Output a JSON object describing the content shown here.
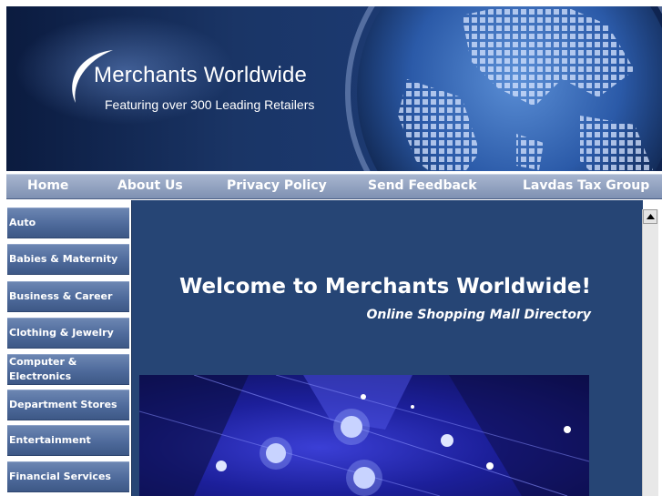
{
  "header": {
    "logo_title": "Merchants Worldwide",
    "logo_tagline": "Featuring over 300 Leading Retailers"
  },
  "nav": {
    "items": [
      "Home",
      "About Us",
      "Privacy Policy",
      "Send Feedback",
      "Lavdas Tax Group"
    ]
  },
  "sidebar": {
    "items": [
      "Auto",
      "Babies & Maternity",
      "Business & Career",
      "Clothing & Jewelry",
      "Computer & Electronics",
      "Department Stores",
      "Entertainment",
      "Financial Services"
    ]
  },
  "main": {
    "welcome": "Welcome to Merchants Worldwide!",
    "subtitle": "Online Shopping Mall Directory"
  },
  "colors": {
    "nav_bg": "#8fa0bf",
    "main_bg": "#264575",
    "sidebar_button": "#5874a4",
    "text": "#ffffff"
  },
  "icons": {
    "scroll_up": "triangle-up-icon",
    "logo": "swoosh-icon"
  }
}
